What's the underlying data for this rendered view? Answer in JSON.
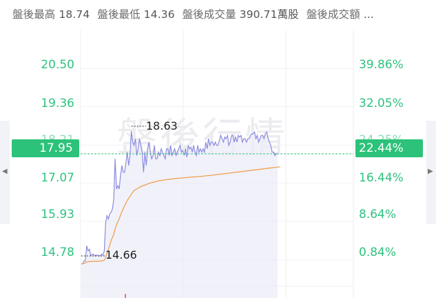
{
  "summary": [
    {
      "label": "盤後最高",
      "value": "18.74"
    },
    {
      "label": "盤後最低",
      "value": "14.36"
    },
    {
      "label": "盤後成交量",
      "value": "390.71萬股"
    },
    {
      "label": "盤後成交額",
      "value": "..."
    }
  ],
  "watermark": "盤後行情",
  "colors": {
    "accent": "#2dc27a",
    "price_line": "#8b8be0",
    "avg_line": "#f0a050",
    "tick_text": "#2ec27e"
  },
  "icons": {
    "left_nav": "triangle-left-icon",
    "right_nav": "triangle-right-icon"
  },
  "chart_data": {
    "type": "line",
    "title": "",
    "ylim": [
      13.64,
      21.64
    ],
    "y_ticks_left": [
      "20.50",
      "19.36",
      "18.21",
      "17.07",
      "15.93",
      "14.78"
    ],
    "y_ticks_right": [
      "39.86%",
      "32.05%",
      "24.25%",
      "16.44%",
      "8.64%",
      "0.84%"
    ],
    "current": {
      "price": "17.95",
      "percent": "22.44%"
    },
    "annotations": {
      "high": "18.63",
      "low": "14.66"
    },
    "series": [
      {
        "values": [
          14.66,
          14.66,
          14.75,
          14.75,
          15.2,
          15.05,
          15.1,
          14.9,
          14.95,
          14.95,
          14.9,
          14.92,
          14.92,
          14.9,
          14.9,
          14.95,
          14.92,
          15.05,
          15.9,
          16.1,
          16.0,
          16.15,
          16.2,
          16.3,
          16.6,
          17.8,
          16.9,
          17.0,
          16.9,
          17.3,
          17.6,
          17.4,
          17.4,
          17.7,
          18.0,
          17.6,
          17.9,
          18.63,
          18.3,
          18.2,
          18.4,
          17.9,
          18.1,
          18.4,
          18.2,
          18.0,
          17.4,
          18.0,
          17.6,
          18.1,
          18.3,
          18.0,
          17.8,
          17.9,
          18.2,
          17.8,
          17.8,
          18.0,
          17.9,
          18.1,
          18.0,
          17.9,
          17.8,
          18.1,
          18.1,
          17.9,
          18.2,
          17.9,
          18.0,
          18.1,
          17.9,
          18.0,
          18.1,
          18.2,
          18.0,
          18.05,
          17.9,
          18.1,
          17.85,
          18.2,
          18.1,
          18.15,
          18.0,
          18.2,
          18.0,
          17.9,
          18.2,
          18.0,
          18.1,
          18.0,
          18.1,
          18.0,
          18.3,
          18.1,
          18.4,
          18.2,
          18.3,
          18.3,
          18.2,
          18.3,
          18.2,
          18.2,
          18.35,
          18.5,
          18.4,
          18.3,
          18.45,
          18.4,
          18.5,
          18.2,
          18.3,
          18.5,
          18.5,
          18.3,
          18.45,
          18.3,
          18.5,
          18.45,
          18.5,
          18.3,
          18.4,
          18.4,
          18.3,
          18.4,
          18.4,
          18.5,
          18.55,
          18.55,
          18.6,
          18.4,
          18.5,
          18.3,
          18.4,
          18.5,
          18.5,
          18.4,
          18.55,
          18.6,
          18.4,
          18.3,
          18.2,
          18.0,
          18.0,
          17.9,
          17.95,
          17.95
        ]
      },
      {
        "values": [
          14.66,
          14.66,
          14.68,
          14.69,
          14.72,
          14.72,
          14.73,
          14.73,
          14.73,
          14.74,
          14.74,
          14.74,
          14.74,
          14.74,
          14.75,
          14.75,
          14.75,
          14.77,
          14.85,
          14.98,
          15.1,
          15.22,
          15.35,
          15.45,
          15.55,
          15.7,
          15.82,
          15.92,
          16.0,
          16.12,
          16.22,
          16.3,
          16.4,
          16.48,
          16.56,
          16.62,
          16.68,
          16.74,
          16.8,
          16.85,
          16.88,
          16.9,
          16.92,
          16.95,
          16.97,
          16.99,
          17.0,
          17.02,
          17.03,
          17.05,
          17.06,
          17.08,
          17.09,
          17.1,
          17.11,
          17.12,
          17.13,
          17.14,
          17.15,
          17.15,
          17.16,
          17.17,
          17.17,
          17.18,
          17.18,
          17.19,
          17.19,
          17.2,
          17.2,
          17.21,
          17.21,
          17.22,
          17.22,
          17.22,
          17.23,
          17.23,
          17.23,
          17.24,
          17.24,
          17.24,
          17.25,
          17.25,
          17.25,
          17.26,
          17.26,
          17.26,
          17.27,
          17.27,
          17.27,
          17.28,
          17.28,
          17.29,
          17.29,
          17.3,
          17.3,
          17.3,
          17.31,
          17.31,
          17.32,
          17.32,
          17.33,
          17.33,
          17.34,
          17.34,
          17.35,
          17.35,
          17.36,
          17.36,
          17.37,
          17.37,
          17.38,
          17.38,
          17.39,
          17.39,
          17.4,
          17.4,
          17.41,
          17.41,
          17.42,
          17.42,
          17.43,
          17.43,
          17.44,
          17.44,
          17.45,
          17.45,
          17.46,
          17.46,
          17.47,
          17.47,
          17.48,
          17.48,
          17.49,
          17.49,
          17.5,
          17.5,
          17.51,
          17.51,
          17.52,
          17.52,
          17.53,
          17.53,
          17.54,
          17.54,
          17.55,
          17.55,
          17.56,
          17.56
        ]
      }
    ]
  }
}
